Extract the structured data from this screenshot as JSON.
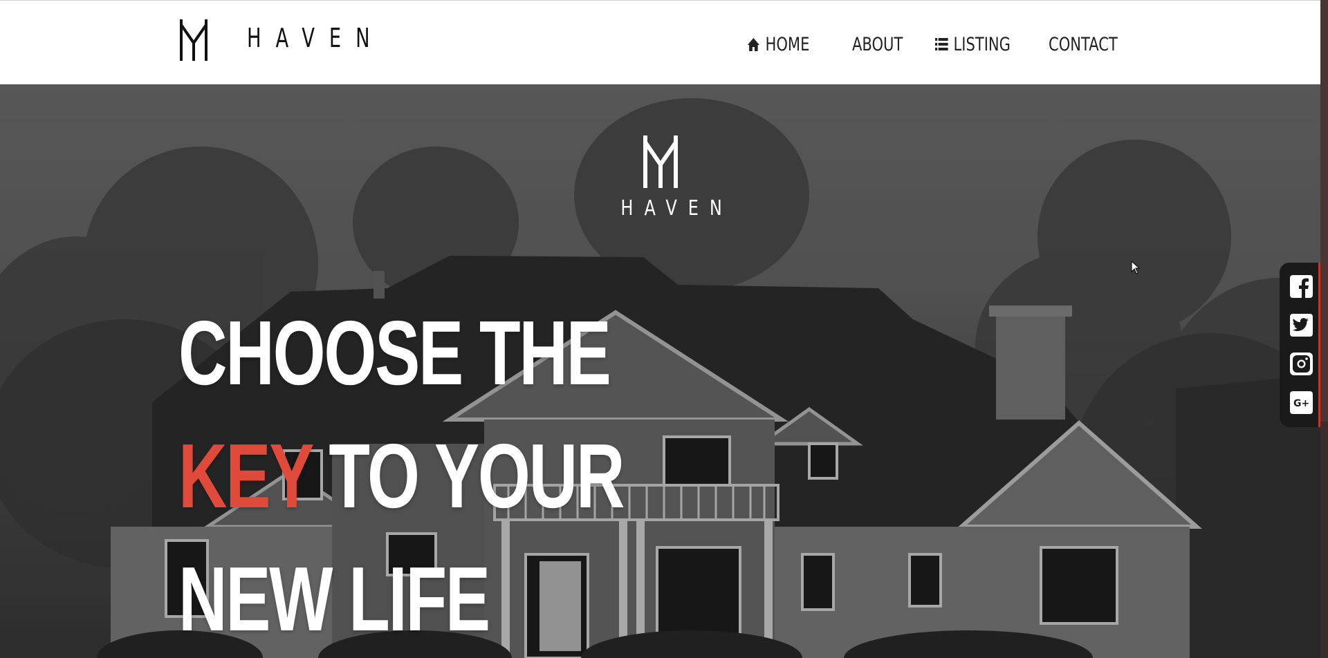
{
  "brand": {
    "name": "HAVEN"
  },
  "nav": {
    "items": [
      {
        "label": "HOME",
        "icon": "home-icon"
      },
      {
        "label": "ABOUT",
        "icon": ""
      },
      {
        "label": "LISTING",
        "icon": "list-icon"
      },
      {
        "label": "CONTACT",
        "icon": ""
      }
    ]
  },
  "hero": {
    "logo_text": "HAVEN",
    "headline": {
      "line1": "CHOOSE THE",
      "line2_accent": "KEY",
      "line2_rest": " TO YOUR",
      "line3": "NEW LIFE"
    },
    "accent_color": "#e04a3a"
  },
  "social": {
    "items": [
      {
        "icon": "facebook-icon"
      },
      {
        "icon": "twitter-icon"
      },
      {
        "icon": "instagram-icon"
      },
      {
        "icon": "google-plus-icon"
      }
    ]
  }
}
